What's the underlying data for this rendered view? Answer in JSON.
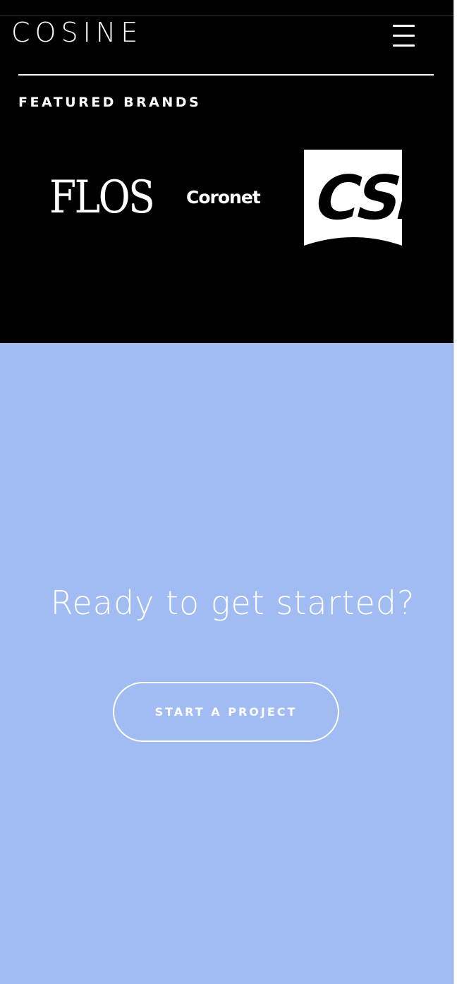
{
  "header": {
    "logo_text": "COSINE",
    "menu_icon": "hamburger-menu-icon"
  },
  "featured": {
    "title": "FEATURED BRANDS",
    "brands": [
      {
        "name": "FLOS"
      },
      {
        "name": "Coronet"
      },
      {
        "name": "CSL"
      }
    ]
  },
  "cta": {
    "heading": "Ready to get started?",
    "button_label": "START A PROJECT"
  },
  "colors": {
    "dark_background": "#000000",
    "cta_background": "#a0bcf3",
    "text": "#ffffff"
  }
}
